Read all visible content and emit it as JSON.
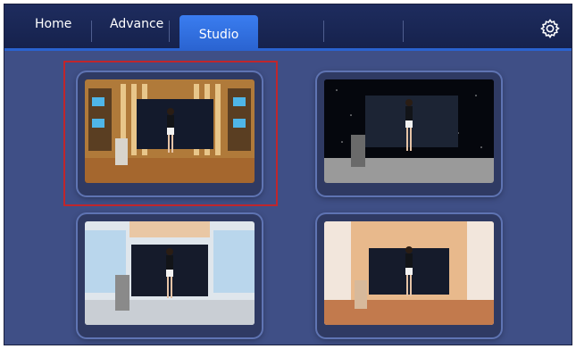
{
  "tabs": [
    {
      "label": "Home",
      "active": false
    },
    {
      "label": "Advance",
      "active": false
    },
    {
      "label": "Studio",
      "active": true
    }
  ],
  "settings_icon": "gear-icon",
  "studios": [
    {
      "id": 1,
      "scene": "bookshelf-studio",
      "selected": true
    },
    {
      "id": 2,
      "scene": "dark-space-studio",
      "selected": false
    },
    {
      "id": 3,
      "scene": "office-glass-studio",
      "selected": false
    },
    {
      "id": 4,
      "scene": "warm-wood-studio",
      "selected": false
    }
  ],
  "colors": {
    "accent": "#2a63d0",
    "selection": "#c0262c",
    "background": "#3f4f86"
  }
}
